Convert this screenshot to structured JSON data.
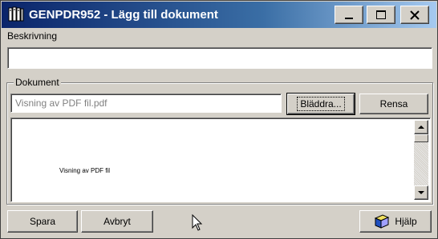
{
  "window": {
    "title": "GENPDR952 - Lägg till dokument",
    "icons": {
      "app": "books-icon",
      "minimize": "minimize-icon",
      "maximize": "maximize-icon",
      "close": "close-icon"
    }
  },
  "description": {
    "label": "Beskrivning",
    "value": ""
  },
  "document_group": {
    "legend": "Dokument",
    "path_value": "Visning av PDF fil.pdf",
    "browse_label": "Bläddra...",
    "clear_label": "Rensa",
    "preview_text": "Visning av PDF fil"
  },
  "footer": {
    "save_label": "Spara",
    "cancel_label": "Avbryt",
    "help_label": "Hjälp",
    "help_icon": "help-book-icon"
  }
}
